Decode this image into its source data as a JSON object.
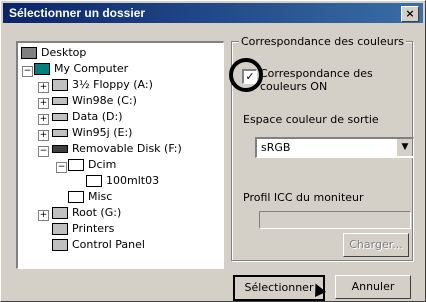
{
  "title": "Sélectionner un dossier",
  "close_label": "×",
  "tree": [
    {
      "label": "Desktop",
      "icon": "desktop-icon"
    },
    {
      "label": "My Computer",
      "icon": "computer-icon"
    },
    {
      "label": "3½ Floppy (A:)",
      "icon": "floppy-icon"
    },
    {
      "label": "Win98e (C:)",
      "icon": "drive-icon"
    },
    {
      "label": "Data (D:)",
      "icon": "drive-icon"
    },
    {
      "label": "Win95j (E:)",
      "icon": "drive-icon"
    },
    {
      "label": "Removable Disk (F:)",
      "icon": "removable-disk-icon"
    },
    {
      "label": "Dcim",
      "icon": "folder-icon"
    },
    {
      "label": "100mlt03",
      "icon": "folder-icon"
    },
    {
      "label": "Misc",
      "icon": "folder-icon"
    },
    {
      "label": "Root (G:)",
      "icon": "network-drive-icon"
    },
    {
      "label": "Printers",
      "icon": "printer-icon"
    },
    {
      "label": "Control Panel",
      "icon": "control-panel-icon"
    }
  ],
  "color_group": {
    "label": "Correspondance des couleurs",
    "checkbox_label_line1": "Correspondance des",
    "checkbox_label_line2": "couleurs ON",
    "checked": true,
    "output_space_label": "Espace couleur de sortie",
    "output_space_value": "sRGB",
    "monitor_icc_label": "Profil ICC du moniteur",
    "monitor_icc_value": "",
    "load_button": "Charger..."
  },
  "buttons": {
    "select": "Sélectionner",
    "cancel": "Annuler"
  }
}
